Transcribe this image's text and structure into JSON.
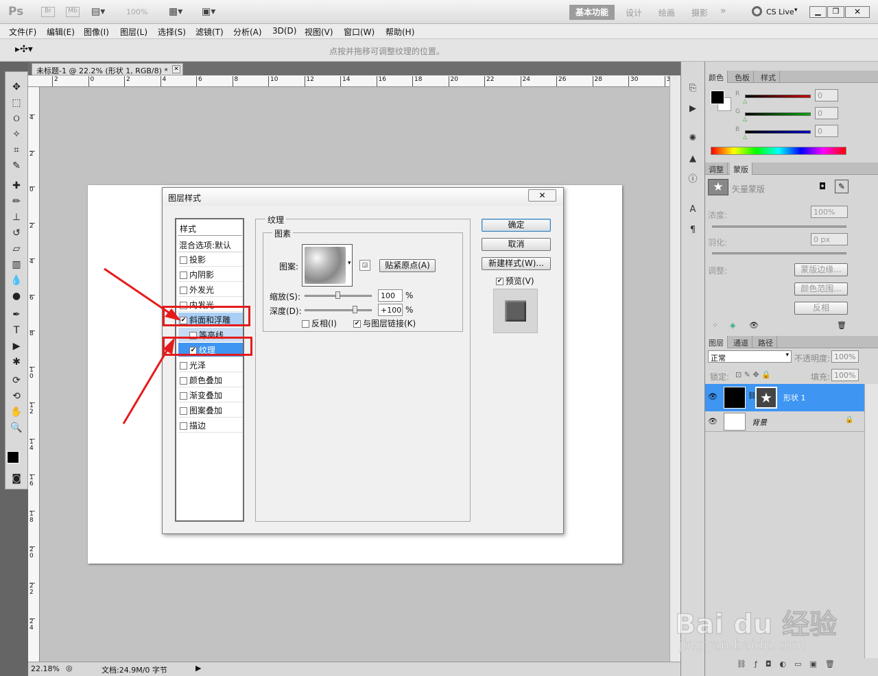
{
  "app": {
    "logo": "Ps",
    "br": "Br",
    "mb": "Mb",
    "zoom": "100%",
    "workspaces": [
      "基本功能",
      "设计",
      "绘画",
      "摄影"
    ],
    "more": "»",
    "cslive": "CS Live"
  },
  "menu": [
    "文件(F)",
    "编辑(E)",
    "图像(I)",
    "图层(L)",
    "选择(S)",
    "滤镜(T)",
    "分析(A)",
    "3D(D)",
    "视图(V)",
    "窗口(W)",
    "帮助(H)"
  ],
  "options": {
    "hint": "点按并拖移可调整纹理的位置。"
  },
  "document": {
    "tab": "未标题-1 @ 22.2% (形状 1, RGB/8) *",
    "zoom": "22.18%",
    "doc_info": "文档:24.9M/0 字节"
  },
  "ruler_h": [
    "2",
    "0",
    "2",
    "4",
    "6",
    "8",
    "10",
    "12",
    "14",
    "16",
    "18",
    "20",
    "22",
    "24",
    "26",
    "28",
    "30",
    "32"
  ],
  "ruler_v": [
    "4",
    "2",
    "0",
    "2",
    "4",
    "6",
    "8",
    "1 0",
    "1 2",
    "1 4",
    "1 6",
    "1 8",
    "2 0",
    "2 2",
    "2 4"
  ],
  "dialog": {
    "title": "图层样式",
    "styles_header": "样式",
    "blend_options": "混合选项:默认",
    "styles": [
      {
        "label": "投影",
        "checked": false
      },
      {
        "label": "内阴影",
        "checked": false
      },
      {
        "label": "外发光",
        "checked": false
      },
      {
        "label": "内发光",
        "checked": false
      },
      {
        "label": "斜面和浮雕",
        "checked": true
      },
      {
        "label": "等高线",
        "checked": false
      },
      {
        "label": "纹理",
        "checked": true
      },
      {
        "label": "光泽",
        "checked": false
      },
      {
        "label": "颜色叠加",
        "checked": false
      },
      {
        "label": "渐变叠加",
        "checked": false
      },
      {
        "label": "图案叠加",
        "checked": false
      },
      {
        "label": "描边",
        "checked": false
      }
    ],
    "section_title": "纹理",
    "group_title": "图素",
    "pattern_label": "图案:",
    "snap_button": "贴紧原点(A)",
    "scale_label": "缩放(S):",
    "scale_value": "100",
    "scale_unit": "%",
    "depth_label": "深度(D):",
    "depth_value": "+100",
    "depth_unit": "%",
    "invert_label": "反相(I)",
    "invert_checked": false,
    "link_label": "与图层链接(K)",
    "link_checked": true,
    "ok": "确定",
    "cancel": "取消",
    "new_style": "新建样式(W)...",
    "preview_label": "预览(V)",
    "preview_checked": true
  },
  "panels": {
    "color": {
      "tabs": [
        "颜色",
        "色板",
        "样式"
      ],
      "channels": [
        {
          "name": "R",
          "value": "0",
          "color": "#cc0000"
        },
        {
          "name": "G",
          "value": "0",
          "color": "#00aa00"
        },
        {
          "name": "B",
          "value": "0",
          "color": "#0000cc"
        }
      ]
    },
    "masks": {
      "tabs": [
        "调整",
        "蒙版"
      ],
      "mask_type": "矢量蒙版",
      "density_label": "浓度:",
      "density_value": "100%",
      "feather_label": "羽化:",
      "feather_value": "0 px",
      "adjust_label": "调整:",
      "mask_edge": "蒙版边缘...",
      "color_range": "颜色范围...",
      "invert": "反相"
    },
    "layers": {
      "tabs": [
        "图层",
        "通道",
        "路径"
      ],
      "blend_mode": "正常",
      "opacity_label": "不透明度:",
      "opacity_value": "100%",
      "lock_label": "锁定:",
      "fill_label": "填充:",
      "fill_value": "100%",
      "items": [
        {
          "name": "形状 1",
          "selected": true
        },
        {
          "name": "背景",
          "selected": false
        }
      ]
    }
  },
  "watermark": {
    "brand": "Bai du 经验",
    "url": "jingyan.baidu.com"
  }
}
